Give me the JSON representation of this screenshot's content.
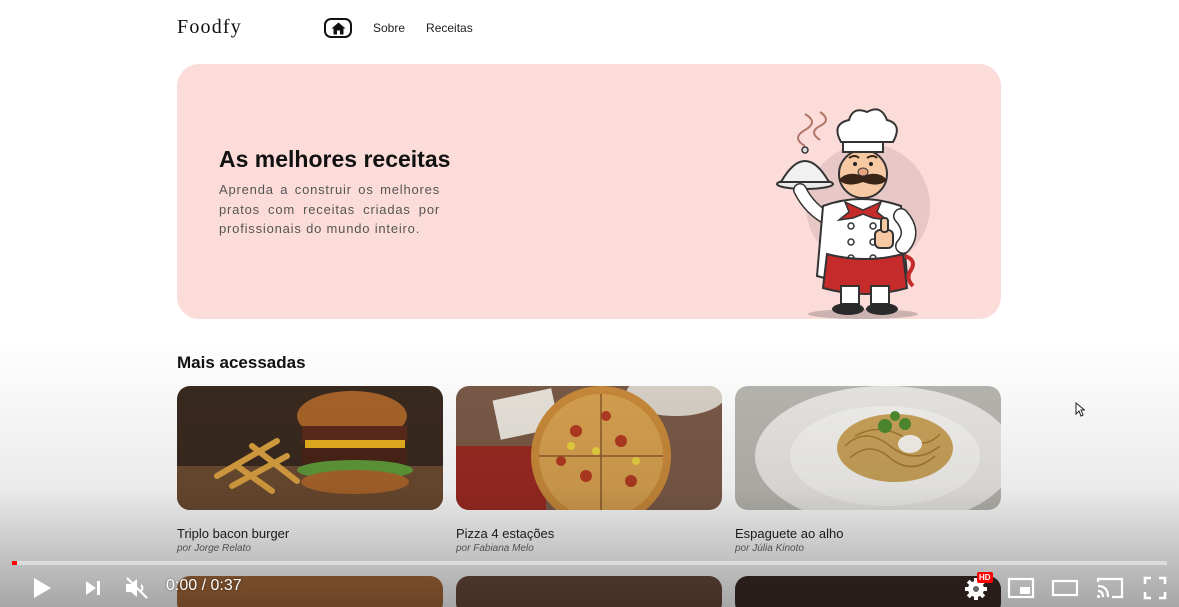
{
  "header": {
    "logo": "Foodfy",
    "nav": [
      {
        "label": "Sobre"
      },
      {
        "label": "Receitas"
      }
    ]
  },
  "hero": {
    "title": "As melhores receitas",
    "text": "Aprenda a construir os melhores pratos com receitas criadas por profissionais do mundo inteiro."
  },
  "section": {
    "title": "Mais acessadas"
  },
  "cards": [
    {
      "title": "Triplo bacon burger",
      "author": "por Jorge Relato"
    },
    {
      "title": "Pizza 4 estações",
      "author": "por Fabiana Melo"
    },
    {
      "title": "Espaguete ao alho",
      "author": "por Júlia Kinoto"
    }
  ],
  "player": {
    "time": "0:00 / 0:37",
    "progress": 0.004,
    "quality_badge": "HD"
  },
  "colors": {
    "hero_bg": "#fcdcd9",
    "progress": "#ff0000"
  }
}
